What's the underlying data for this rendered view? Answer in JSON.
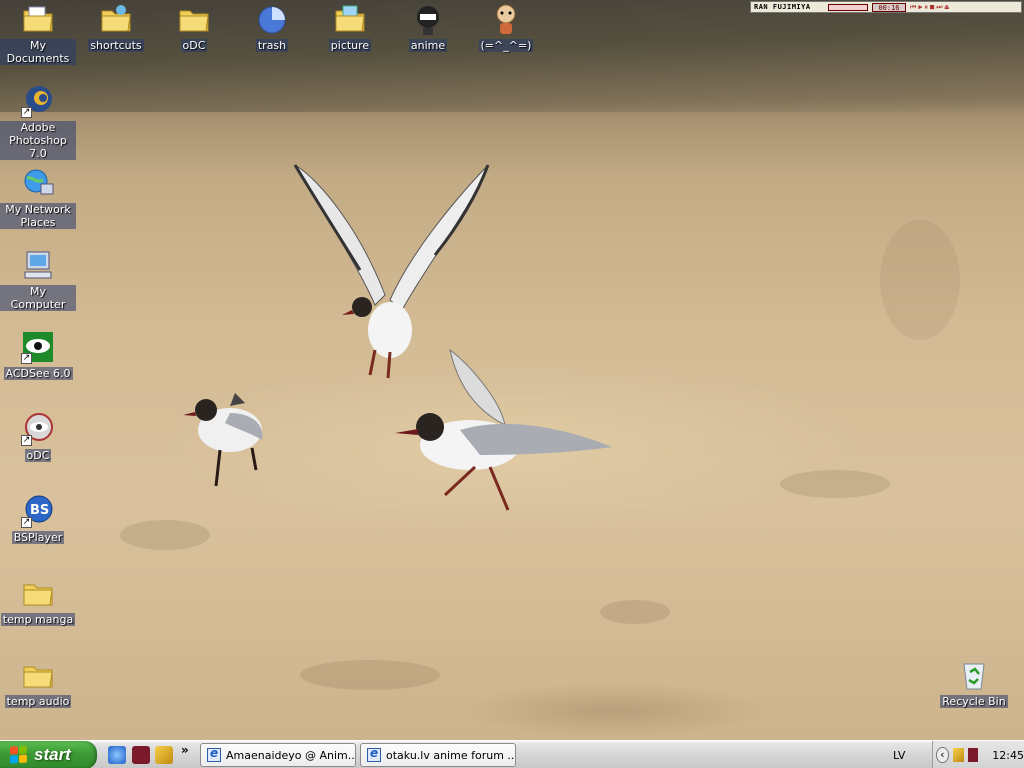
{
  "desktop": {
    "top_icons": [
      {
        "label": "My Documents",
        "icon": "my-documents-icon"
      },
      {
        "label": "shortcuts",
        "icon": "folder-shortcuts-icon"
      },
      {
        "label": "oDC",
        "icon": "folder-icon"
      },
      {
        "label": "trash",
        "icon": "trash-pie-icon"
      },
      {
        "label": "picture",
        "icon": "picture-folder-icon"
      },
      {
        "label": "anime",
        "icon": "anime-character-icon"
      },
      {
        "label": "(=^_^=)",
        "icon": "cat-face-icon"
      }
    ],
    "left_icons": [
      {
        "label": "Adobe Photoshop 7.0",
        "icon": "photoshop-icon"
      },
      {
        "label": "My Network Places",
        "icon": "network-places-icon"
      },
      {
        "label": "My Computer",
        "icon": "my-computer-icon"
      },
      {
        "label": "ACDSee 6.0",
        "icon": "acdsee-icon"
      },
      {
        "label": "oDC",
        "icon": "odc-eye-icon"
      },
      {
        "label": "BSPlayer",
        "icon": "bsplayer-icon"
      },
      {
        "label": "temp manga",
        "icon": "folder-icon"
      },
      {
        "label": "temp audio",
        "icon": "folder-icon"
      }
    ],
    "recycle_bin": {
      "label": "Recycle Bin",
      "icon": "recycle-bin-icon"
    }
  },
  "player": {
    "title": "RAN FUJIMIYA",
    "time": "00:16",
    "buttons": [
      "prev-icon",
      "play-icon",
      "pause-icon",
      "stop-icon",
      "next-icon",
      "eject-icon"
    ]
  },
  "taskbar": {
    "start_label": "start",
    "quick_launch": [
      "internet-explorer-icon",
      "app-icon",
      "pencil-icon"
    ],
    "more_label": "»",
    "tasks": [
      {
        "label": "Amaenaideyo @ Anim..."
      },
      {
        "label": "otaku.lv anime forum ..."
      }
    ],
    "language": "LV",
    "clock": "12:45"
  },
  "colors": {
    "start_green": "#3c9a35",
    "taskbar_gray": "#d6d6d6",
    "sand": "#d2ba94"
  }
}
